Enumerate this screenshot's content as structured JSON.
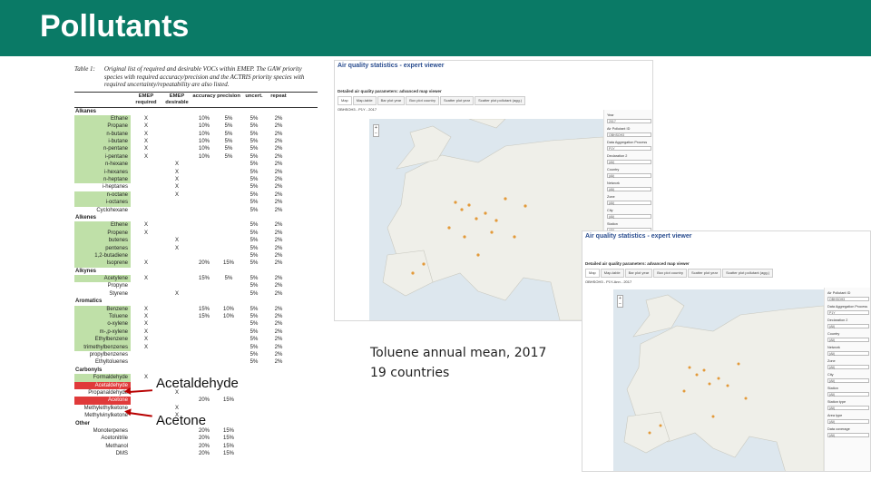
{
  "slide": {
    "title": "Pollutants"
  },
  "table": {
    "label": "Table 1:",
    "caption": "Original list of required and desirable VOCs within EMEP. The GAW priority species with required accuracy/precision and the ACTRIS priority species with required uncertainty/repeatability are also listed.",
    "headers": {
      "emep_req": "EMEP required",
      "emep_des": "EMEP desirable",
      "gaw": "GAW priority¹",
      "actris": "ACTRIS priority²",
      "accuracy": "accuracy",
      "precision": "precision",
      "uncert": "uncert.",
      "repeat": "repeat"
    },
    "rows": [
      {
        "name": "Alkanes",
        "cat": true
      },
      {
        "name": "Ethane",
        "hl": true,
        "req": "X",
        "des": "",
        "acc": "10%",
        "prec": "5%",
        "unc": "5%",
        "rep": "2%"
      },
      {
        "name": "Propane",
        "hl": true,
        "req": "X",
        "des": "",
        "acc": "10%",
        "prec": "5%",
        "unc": "5%",
        "rep": "2%"
      },
      {
        "name": "n-butane",
        "hl": true,
        "req": "X",
        "des": "",
        "acc": "10%",
        "prec": "5%",
        "unc": "5%",
        "rep": "2%"
      },
      {
        "name": "i-butane",
        "hl": true,
        "req": "X",
        "des": "",
        "acc": "10%",
        "prec": "5%",
        "unc": "5%",
        "rep": "2%"
      },
      {
        "name": "n-pentane",
        "hl": true,
        "req": "X",
        "des": "",
        "acc": "10%",
        "prec": "5%",
        "unc": "5%",
        "rep": "2%"
      },
      {
        "name": "i-pentane",
        "hl": true,
        "req": "X",
        "des": "",
        "acc": "10%",
        "prec": "5%",
        "unc": "5%",
        "rep": "2%"
      },
      {
        "name": "n-hexane",
        "hl": true,
        "req": "",
        "des": "X",
        "acc": "",
        "prec": "",
        "unc": "5%",
        "rep": "2%"
      },
      {
        "name": "i-hexanes",
        "hl": true,
        "req": "",
        "des": "X",
        "acc": "",
        "prec": "",
        "unc": "5%",
        "rep": "2%"
      },
      {
        "name": "n-heptane",
        "hl": true,
        "req": "",
        "des": "X",
        "acc": "",
        "prec": "",
        "unc": "5%",
        "rep": "2%"
      },
      {
        "name": "i-heptanes",
        "hl": false,
        "req": "",
        "des": "X",
        "acc": "",
        "prec": "",
        "unc": "5%",
        "rep": "2%"
      },
      {
        "name": "n-octane",
        "hl": true,
        "req": "",
        "des": "X",
        "acc": "",
        "prec": "",
        "unc": "5%",
        "rep": "2%"
      },
      {
        "name": "i-octanes",
        "hl": true,
        "req": "",
        "des": "",
        "acc": "",
        "prec": "",
        "unc": "5%",
        "rep": "2%"
      },
      {
        "name": "Cyclohexane",
        "hl": false,
        "req": "",
        "des": "",
        "acc": "",
        "prec": "",
        "unc": "5%",
        "rep": "2%"
      },
      {
        "name": "Alkenes",
        "cat": true
      },
      {
        "name": "Ethene",
        "hl": true,
        "req": "X",
        "des": "",
        "acc": "",
        "prec": "",
        "unc": "5%",
        "rep": "2%"
      },
      {
        "name": "Propene",
        "hl": true,
        "req": "X",
        "des": "",
        "acc": "",
        "prec": "",
        "unc": "5%",
        "rep": "2%"
      },
      {
        "name": "butenes",
        "hl": true,
        "req": "",
        "des": "X",
        "acc": "",
        "prec": "",
        "unc": "5%",
        "rep": "2%"
      },
      {
        "name": "pentenes",
        "hl": true,
        "req": "",
        "des": "X",
        "acc": "",
        "prec": "",
        "unc": "5%",
        "rep": "2%"
      },
      {
        "name": "1,2-butadiene",
        "hl": true,
        "req": "",
        "des": "",
        "acc": "",
        "prec": "",
        "unc": "5%",
        "rep": "2%"
      },
      {
        "name": "Isoprene",
        "hl": true,
        "req": "X",
        "des": "",
        "acc": "20%",
        "prec": "15%",
        "unc": "5%",
        "rep": "2%"
      },
      {
        "name": "Alkynes",
        "cat": true
      },
      {
        "name": "Acetylene",
        "hl": true,
        "req": "X",
        "des": "",
        "acc": "15%",
        "prec": "5%",
        "unc": "5%",
        "rep": "2%"
      },
      {
        "name": "Propyne",
        "hl": false,
        "req": "",
        "des": "",
        "acc": "",
        "prec": "",
        "unc": "5%",
        "rep": "2%"
      },
      {
        "name": "Styrene",
        "hl": false,
        "req": "",
        "des": "X",
        "acc": "",
        "prec": "",
        "unc": "5%",
        "rep": "2%"
      },
      {
        "name": "Aromatics",
        "cat": true
      },
      {
        "name": "Benzene",
        "hl": true,
        "req": "X",
        "des": "",
        "acc": "15%",
        "prec": "10%",
        "unc": "5%",
        "rep": "2%"
      },
      {
        "name": "Toluene",
        "hl": true,
        "req": "X",
        "des": "",
        "acc": "15%",
        "prec": "10%",
        "unc": "5%",
        "rep": "2%"
      },
      {
        "name": "o-xylene",
        "hl": true,
        "req": "X",
        "des": "",
        "acc": "",
        "prec": "",
        "unc": "5%",
        "rep": "2%"
      },
      {
        "name": "m-,p-xylene",
        "hl": true,
        "req": "X",
        "des": "",
        "acc": "",
        "prec": "",
        "unc": "5%",
        "rep": "2%"
      },
      {
        "name": "Ethylbenzene",
        "hl": true,
        "req": "X",
        "des": "",
        "acc": "",
        "prec": "",
        "unc": "5%",
        "rep": "2%"
      },
      {
        "name": "trimethylbenzenes",
        "hl": true,
        "req": "X",
        "des": "",
        "acc": "",
        "prec": "",
        "unc": "5%",
        "rep": "2%"
      },
      {
        "name": "propylbenzenes",
        "hl": false,
        "req": "",
        "des": "",
        "acc": "",
        "prec": "",
        "unc": "5%",
        "rep": "2%"
      },
      {
        "name": "Ethyltoluenes",
        "hl": false,
        "req": "",
        "des": "",
        "acc": "",
        "prec": "",
        "unc": "5%",
        "rep": "2%"
      },
      {
        "name": "Carbonyls",
        "cat": true
      },
      {
        "name": "Formaldehyde",
        "hl": true,
        "req": "X",
        "des": "",
        "acc": "",
        "prec": "",
        "unc": "",
        "rep": ""
      },
      {
        "name": "Acetaldehyde",
        "hl": "red",
        "req": "",
        "des": "",
        "acc": "",
        "prec": "",
        "unc": "",
        "rep": ""
      },
      {
        "name": "Propanaldehyde",
        "hl": false,
        "req": "",
        "des": "X",
        "acc": "",
        "prec": "",
        "unc": "",
        "rep": ""
      },
      {
        "name": "Acetone",
        "hl": "red",
        "req": "",
        "des": "",
        "acc": "20%",
        "prec": "15%",
        "unc": "",
        "rep": ""
      },
      {
        "name": "Methylethylketone",
        "hl": false,
        "req": "",
        "des": "X",
        "acc": "",
        "prec": "",
        "unc": "",
        "rep": ""
      },
      {
        "name": "Methylvinylketone",
        "hl": false,
        "req": "",
        "des": "X",
        "acc": "",
        "prec": "",
        "unc": "",
        "rep": ""
      },
      {
        "name": "Other",
        "cat": true
      },
      {
        "name": "Monoterpenes",
        "hl": false,
        "req": "",
        "des": "",
        "acc": "20%",
        "prec": "15%",
        "unc": "",
        "rep": ""
      },
      {
        "name": "Acetonitrile",
        "hl": false,
        "req": "",
        "des": "",
        "acc": "20%",
        "prec": "15%",
        "unc": "",
        "rep": ""
      },
      {
        "name": "Methanol",
        "hl": false,
        "req": "",
        "des": "",
        "acc": "20%",
        "prec": "15%",
        "unc": "",
        "rep": ""
      },
      {
        "name": "DMS",
        "hl": false,
        "req": "",
        "des": "",
        "acc": "20%",
        "prec": "15%",
        "unc": "",
        "rep": ""
      }
    ]
  },
  "annotations": {
    "acetaldehyde": "Acetaldehyde",
    "acetone": "Acetone"
  },
  "viewer1": {
    "title": "Air quality statistics - expert viewer",
    "subheading": "Detailed air quality parameters: advanced map viewer",
    "tabs": [
      "Map",
      "Map-table",
      "Bar plot year",
      "Box plot country",
      "Scatter plot year",
      "Scatter plot pollutant (agg.)"
    ],
    "map_label": "OBHSOH3 - P1Y - 2017",
    "filters": [
      "Year",
      "Air Pollutant ID",
      "Data Aggregation Process",
      "Declaration 2",
      "Country",
      "Network",
      "Zone",
      "City",
      "Station"
    ],
    "filter_values": [
      "2017",
      "OBHSOH3",
      "P1Y",
      "(All)",
      "(All)",
      "(All)",
      "(All)",
      "(All)",
      "(All)"
    ]
  },
  "viewer2": {
    "title": "Air quality statistics - expert viewer",
    "subheading": "Detailed air quality parameters: advanced map viewer",
    "tabs": [
      "Map",
      "Map-table",
      "Bar plot year",
      "Box plot country",
      "Scatter plot year",
      "Scatter plot pollutant (agg.)"
    ],
    "map_label": "OBHSOH3 - P1Y-Ann - 2017",
    "filters": [
      "Air Pollutant ID",
      "Data Aggregation Process",
      "Declaration 2",
      "Country",
      "Network",
      "Zone",
      "City",
      "Station",
      "Station type",
      "Area type",
      "Data coverage"
    ],
    "filter_values": [
      "OBHSOH3",
      "P1Y",
      "(All)",
      "(All)",
      "(All)",
      "(All)",
      "(All)",
      "(All)",
      "(All)",
      "(All)",
      "(All)"
    ]
  },
  "caption": {
    "line1": "Toluene annual mean, 2017",
    "line2": "19 countries"
  },
  "colors": {
    "title_bar": "#0a7a66",
    "highlight_green": "#bfe0a8",
    "highlight_red": "#e03a3a",
    "arrow": "#b80000"
  }
}
